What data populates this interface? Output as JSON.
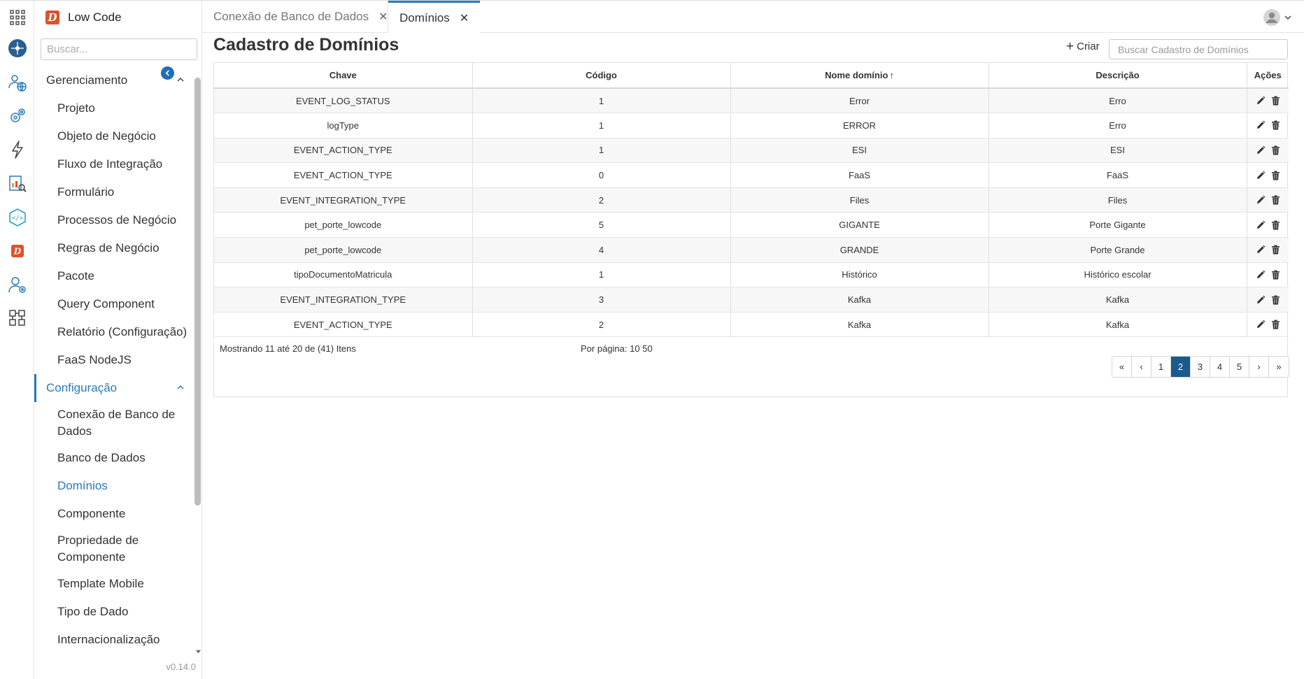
{
  "brand": {
    "name": "Low Code",
    "logo_letter": "D"
  },
  "sidebar": {
    "search_placeholder": "Buscar...",
    "groups": [
      {
        "label": "Gerenciamento",
        "items": [
          "Projeto",
          "Objeto de Negócio",
          "Fluxo de Integração",
          "Formulário",
          "Processos de Negócio",
          "Regras de Negócio",
          "Pacote",
          "Query Component",
          "Relatório (Configuração)",
          "FaaS NodeJS"
        ]
      },
      {
        "label": "Configuração",
        "items": [
          "Conexão de Banco de Dados",
          "Banco de Dados",
          "Domínios",
          "Componente",
          "Propriedade de Componente",
          "Template Mobile",
          "Tipo de Dado",
          "Internacionalização"
        ]
      }
    ],
    "active_item": "Domínios",
    "version": "v0.14.0"
  },
  "tabs": [
    {
      "label": "Conexão de Banco de Dados",
      "close": "✕"
    },
    {
      "label": "Domínios",
      "close": "✕"
    }
  ],
  "page": {
    "title": "Cadastro de Domínios",
    "create_label": "Criar",
    "search_placeholder": "Buscar Cadastro de Domínios"
  },
  "table": {
    "columns": [
      "Chave",
      "Código",
      "Nome domínio",
      "Descrição",
      "Ações"
    ],
    "sort_indicator": "↑",
    "rows": [
      [
        "EVENT_LOG_STATUS",
        "1",
        "Error",
        "Erro"
      ],
      [
        "logType",
        "1",
        "ERROR",
        "Erro"
      ],
      [
        "EVENT_ACTION_TYPE",
        "1",
        "ESI",
        "ESI"
      ],
      [
        "EVENT_ACTION_TYPE",
        "0",
        "FaaS",
        "FaaS"
      ],
      [
        "EVENT_INTEGRATION_TYPE",
        "2",
        "Files",
        "Files"
      ],
      [
        "pet_porte_lowcode",
        "5",
        "GIGANTE",
        "Porte Gigante"
      ],
      [
        "pet_porte_lowcode",
        "4",
        "GRANDE",
        "Porte Grande"
      ],
      [
        "tipoDocumentoMatricula",
        "1",
        "Histórico",
        "Histórico escolar"
      ],
      [
        "EVENT_INTEGRATION_TYPE",
        "3",
        "Kafka",
        "Kafka"
      ],
      [
        "EVENT_ACTION_TYPE",
        "2",
        "Kafka",
        "Kafka"
      ]
    ]
  },
  "footer": {
    "showing": "Mostrando 11 até 20 de (41) Itens",
    "per_page_label": "Por página:",
    "per_page_options": [
      "10",
      "50"
    ]
  },
  "pagination": {
    "pages": [
      "«",
      "‹",
      "1",
      "2",
      "3",
      "4",
      "5",
      "›",
      "»"
    ],
    "current": "2"
  },
  "colors": {
    "accent": "#2a7ab8",
    "pager_active": "#1a5a8c",
    "brand": "#e0502a"
  }
}
